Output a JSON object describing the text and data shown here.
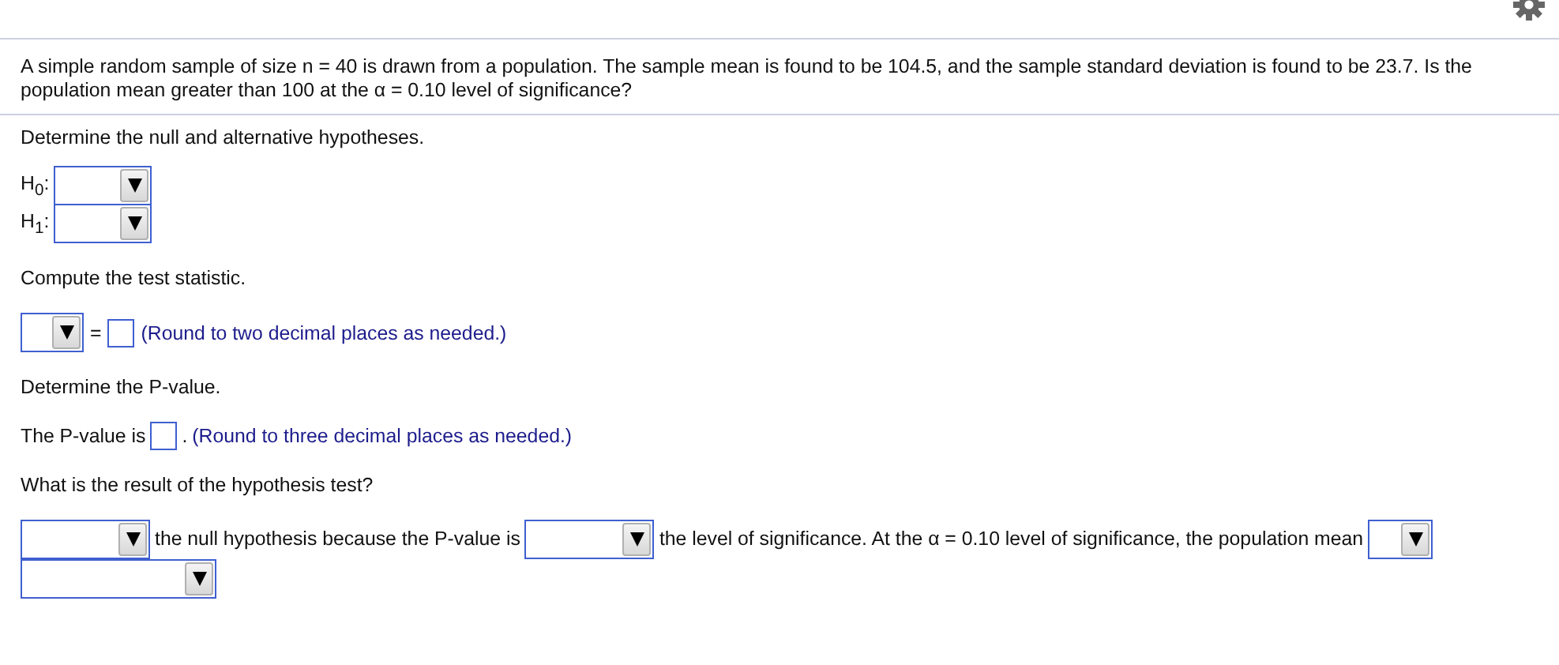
{
  "question": "A simple random sample of size n = 40 is drawn from a population. The sample mean is found to be 104.5, and the sample standard deviation is found to be 23.7. Is the population mean greater than 100 at the α = 0.10 level of significance?",
  "steps": [
    {
      "kind": "prompt",
      "text": "Determine the null and alternative hypotheses."
    },
    {
      "kind": "hypotheses",
      "rows": [
        {
          "label": "H$_{0}$:"
        },
        {
          "label": "H$_{1}$:"
        }
      ]
    },
    {
      "kind": "prompt",
      "text": "Compute the test statistic."
    },
    {
      "kind": "statistic",
      "equals": "=",
      "hint": "(Round to two decimal places as needed.)"
    },
    {
      "kind": "prompt",
      "text": "Determine the P-value."
    },
    {
      "kind": "pvalue",
      "label": "The P-value is",
      "after": ".",
      "hint": "(Round to three decimal places as needed.)"
    },
    {
      "kind": "prompt",
      "text": "What is the result of the hypothesis test?"
    },
    {
      "kind": "conclusion",
      "pieces": [
        {
          "kind": "dropdown"
        },
        {
          "kind": "text",
          "text": "the null hypothesis because the P-value is"
        },
        {
          "kind": "dropdown"
        },
        {
          "kind": "text",
          "text": "the level of significance. At the α = 0.10 level of significance, the population mean"
        },
        {
          "kind": "dropdown"
        },
        {
          "kind": "break"
        },
        {
          "kind": "dropdown"
        }
      ]
    }
  ]
}
